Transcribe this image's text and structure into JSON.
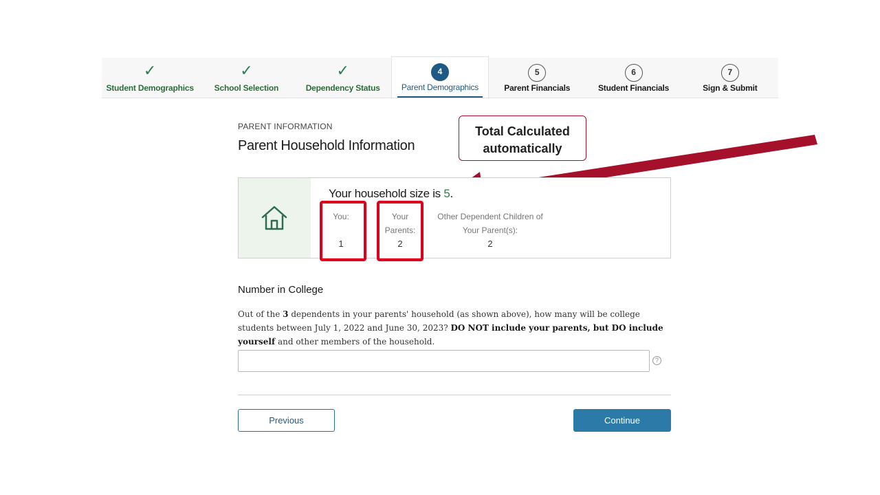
{
  "stepper": {
    "steps": [
      {
        "label": "Student Demographics",
        "marker": "",
        "state": "done"
      },
      {
        "label": "School Selection",
        "marker": "",
        "state": "done"
      },
      {
        "label": "Dependency Status",
        "marker": "",
        "state": "done"
      },
      {
        "label": "Parent Demographics",
        "marker": "4",
        "state": "active"
      },
      {
        "label": "Parent Financials",
        "marker": "5",
        "state": "upcoming"
      },
      {
        "label": "Student Financials",
        "marker": "6",
        "state": "upcoming"
      },
      {
        "label": "Sign & Submit",
        "marker": "7",
        "state": "upcoming"
      }
    ],
    "check_glyph": "✓",
    "done_color": "#2e7d4f",
    "active_color": "#1f5a85"
  },
  "page": {
    "eyebrow": "PARENT INFORMATION",
    "title": "Parent Household Information"
  },
  "callout": {
    "line1": "Total Calculated",
    "line2": "automatically",
    "color": "#a5102b"
  },
  "household": {
    "icon": "house-icon",
    "size_prefix": "Your household size is",
    "size_value": "5",
    "size_suffix": ".",
    "you_label": "You:",
    "you_value": "1",
    "parents_label_1": "Your",
    "parents_label_2": "Parents:",
    "parents_value": "2",
    "other_label_1": "Other Dependent Children of",
    "other_label_2": "Your Parent(s):",
    "other_value": "2",
    "highlight_color": "#e0001b"
  },
  "college": {
    "title": "Number in College",
    "q_part1": "Out of the ",
    "q_bold1": "3",
    "q_part2": " dependents in your parents' household (as shown above), how many will be college students between July 1, 2022 and June 30, 2023? ",
    "q_bold2": "DO NOT include your parents, but DO include yourself",
    "q_part3": " and other members of the household.",
    "input_value": "",
    "help_glyph": "?"
  },
  "buttons": {
    "previous": "Previous",
    "continue": "Continue"
  }
}
